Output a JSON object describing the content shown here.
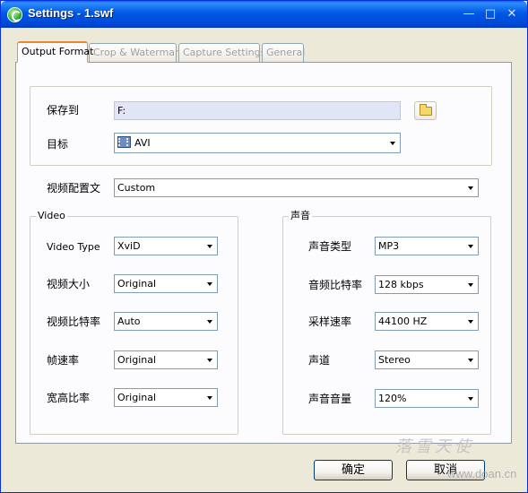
{
  "window": {
    "title": "Settings - 1.swf",
    "minimize": "—",
    "maximize": "□",
    "close": "✕"
  },
  "tabs": [
    "Output Format",
    "Crop & Watermark",
    "Capture Settings",
    "General"
  ],
  "output": {
    "save_to_label": "保存到",
    "save_to_value": "F:",
    "target_label": "目标",
    "target_value": "AVI",
    "profile_label": "视频配置文",
    "profile_value": "Custom"
  },
  "video": {
    "title": "Video",
    "rows": [
      {
        "label": "Video Type",
        "value": "XviD"
      },
      {
        "label": "视频大小",
        "value": "Original"
      },
      {
        "label": "视频比特率",
        "value": "Auto"
      },
      {
        "label": "帧速率",
        "value": "Original"
      },
      {
        "label": "宽高比率",
        "value": "Original"
      }
    ]
  },
  "audio": {
    "title": "声音",
    "rows": [
      {
        "label": "声音类型",
        "value": "MP3"
      },
      {
        "label": "音频比特率",
        "value": "128 kbps"
      },
      {
        "label": "采样速率",
        "value": "44100 HZ"
      },
      {
        "label": "声道",
        "value": "Stereo"
      },
      {
        "label": "声音音量",
        "value": "120%"
      }
    ]
  },
  "buttons": {
    "ok": "确定",
    "cancel": "取消"
  },
  "watermark": {
    "text": "落雪天使",
    "url": "www.doan.cn"
  },
  "icons": {
    "app": "app-logo-icon",
    "folder": "folder-open-icon",
    "avi": "film-icon"
  },
  "colors": {
    "titlebar": "#0058e6",
    "tab_active_accent": "#e68b2c",
    "panel_bg": "#fcfcfe",
    "window_bg": "#ece9d8"
  }
}
